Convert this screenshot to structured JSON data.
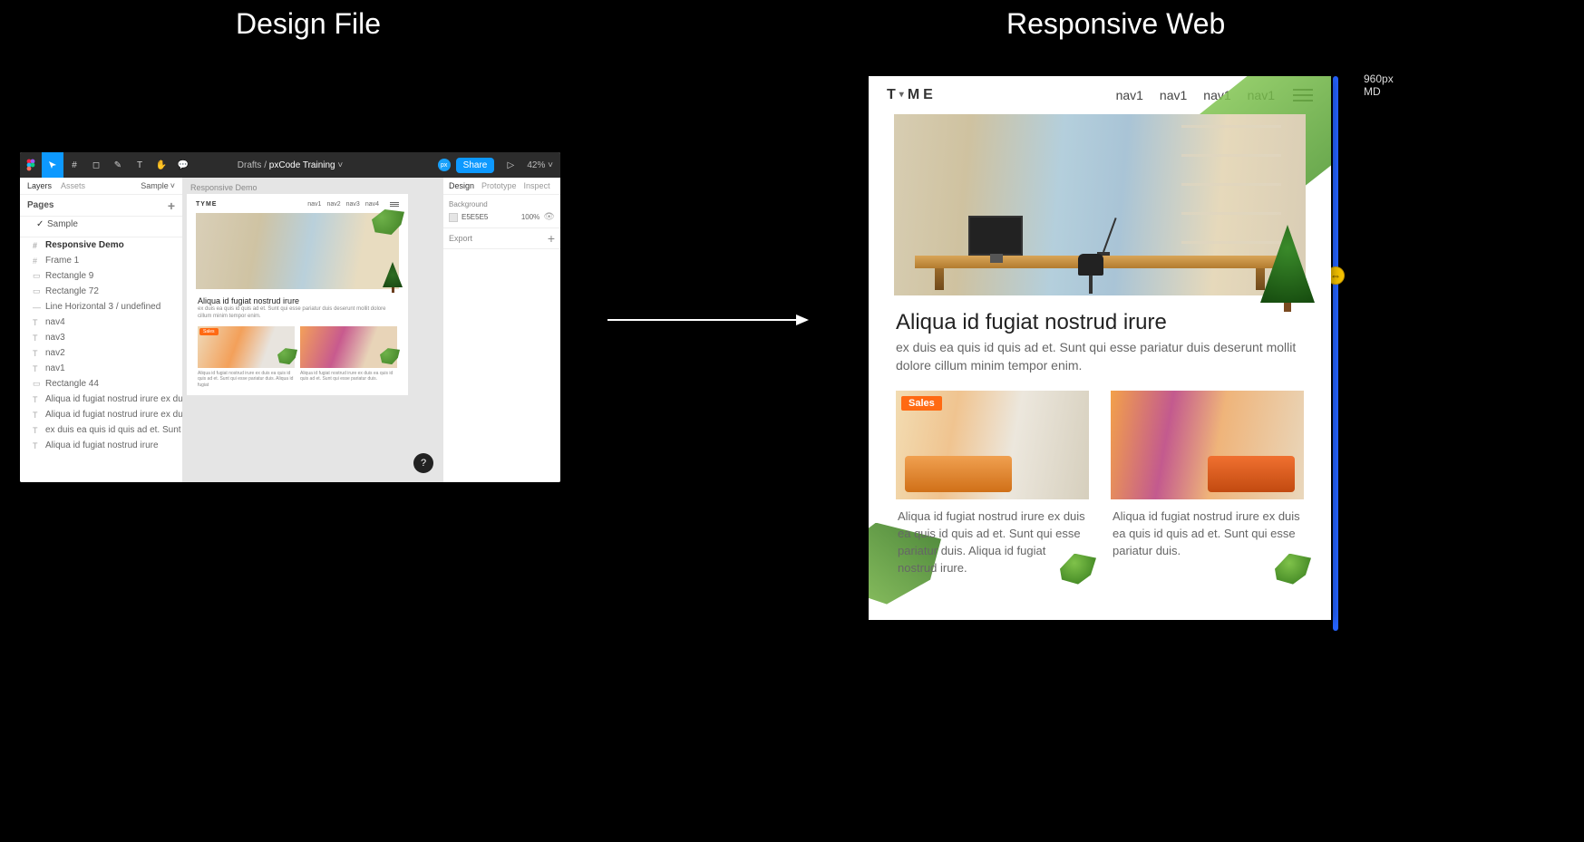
{
  "titles": {
    "left": "Design File",
    "right": "Responsive Web"
  },
  "figma": {
    "breadcrumb_prefix": "Drafts",
    "breadcrumb_sep": "/",
    "breadcrumb_file": "pxCode Training",
    "share_label": "Share",
    "zoom": "42%",
    "px_badge": "px",
    "left_panel": {
      "tab_layers": "Layers",
      "tab_assets": "Assets",
      "dropdown": "Sample",
      "pages_label": "Pages",
      "page_selected": "Sample",
      "root_layer": "Responsive Demo",
      "layers": [
        "Frame 1",
        "Rectangle 9",
        "Rectangle 72",
        "Line Horizontal 3 / undefined",
        "nav4",
        "nav3",
        "nav2",
        "nav1",
        "Rectangle 44",
        "Aliqua id fugiat nostrud irure ex duis ea qui...",
        "Aliqua id fugiat nostrud irure ex duis ea qui...",
        "ex duis ea quis id quis ad et. Sunt qui esse...",
        "Aliqua id fugiat nostrud irure"
      ]
    },
    "canvas": {
      "frame_label": "Responsive Demo",
      "logo": "TYME",
      "nav": [
        "nav1",
        "nav2",
        "nav3",
        "nav4"
      ],
      "heading": "Aliqua id fugiat nostrud irure",
      "subtext": "ex duis ea quis id quis ad et. Sunt qui esse pariatur duis deserunt mollit dolore cillum minim tempor enim.",
      "sales_badge": "Sales",
      "card1_text": "Aliqua id fugiat nostrud irure ex duis ea quis id quis ad et. Sunt qui esse pariatur duis.  Aliqua id fugiat",
      "card2_text": "Aliqua id fugiat nostrud irure ex duis ea quis id quis ad et. Sunt qui esse pariatur duis."
    },
    "right_panel": {
      "tab_design": "Design",
      "tab_prototype": "Prototype",
      "tab_inspect": "Inspect",
      "background_label": "Background",
      "bg_hex": "E5E5E5",
      "bg_opacity": "100%",
      "export_label": "Export"
    },
    "help": "?"
  },
  "web": {
    "width_label": "960px",
    "breakpoint_label": "MD",
    "logo": "T Y M E",
    "nav": [
      "nav1",
      "nav1",
      "nav1",
      "nav1"
    ],
    "heading": "Aliqua id fugiat nostrud irure",
    "subtext": " ex duis ea quis id quis ad et. Sunt qui esse pariatur duis deserunt mollit dolore cillum minim tempor enim.",
    "sales_badge": "Sales",
    "card1_text": "Aliqua id fugiat nostrud irure ex duis ea quis id quis ad et. Sunt qui esse pariatur duis.  Aliqua id fugiat nostrud irure.",
    "card2_text": "Aliqua id fugiat nostrud irure ex duis ea quis id quis ad et. Sunt qui esse pariatur duis."
  }
}
